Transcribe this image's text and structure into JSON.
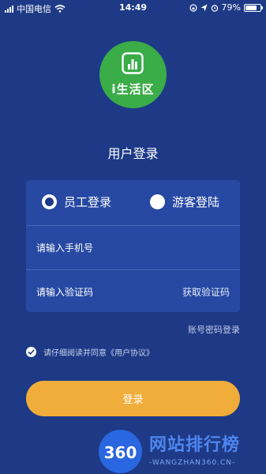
{
  "status_bar": {
    "carrier": "中国电信",
    "time": "14:49",
    "battery_percent": "79%",
    "battery_level": 0.79,
    "icons": [
      "signal-icon",
      "wifi-icon",
      "rotation-lock-icon",
      "location-icon",
      "alarm-icon",
      "battery-icon"
    ]
  },
  "logo": {
    "text": "i生活区"
  },
  "title": "用户登录",
  "roles": [
    {
      "label": "员工登录",
      "selected": true
    },
    {
      "label": "游客登陆",
      "selected": false
    }
  ],
  "phone_field": {
    "placeholder": "请输入手机号",
    "value": ""
  },
  "code_field": {
    "placeholder": "请输入验证码",
    "value": "",
    "action": "获取验证码"
  },
  "password_login": "账号密码登录",
  "agreement": {
    "checked": true,
    "text": "请仔细阅读并同意《用户协议》"
  },
  "login_button": "登录",
  "watermark": {
    "number": "360",
    "name": "网站排行榜",
    "url": "-WANGZHAN360.CN-"
  },
  "colors": {
    "background": "#1e3a86",
    "card": "#2749a3",
    "accent": "#f0ad39",
    "logo": "#3aac48"
  }
}
